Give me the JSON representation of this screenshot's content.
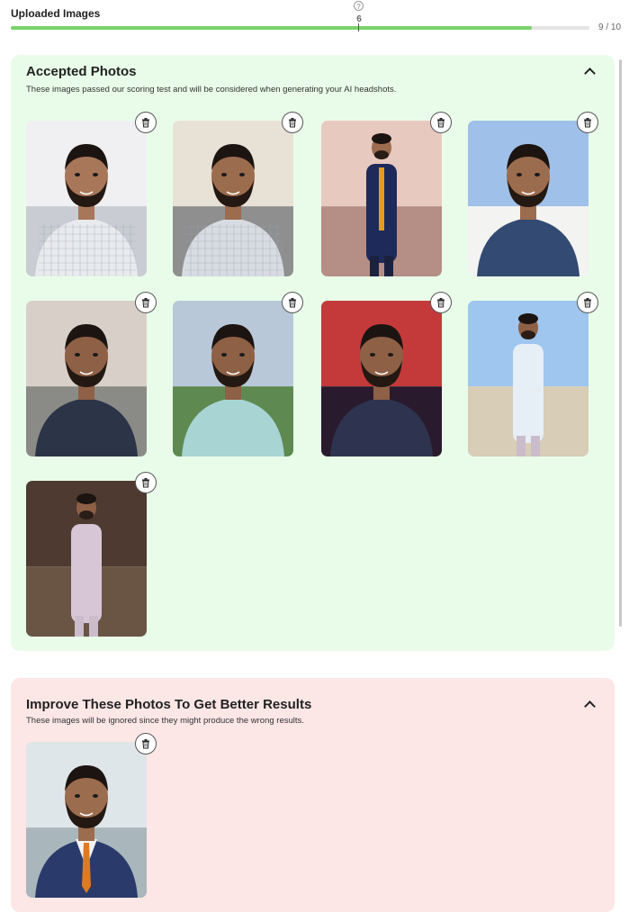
{
  "header": {
    "title": "Uploaded Images",
    "help_icon": "question-circle-icon",
    "marker_label": "6",
    "count_text": "9 / 10",
    "progress": 0.9,
    "accent_color": "#7ad26a"
  },
  "accepted": {
    "title": "Accepted Photos",
    "subtitle": "These images passed our scoring test and will be considered when generating your AI headshots.",
    "background": "#e9fce9",
    "photos": [
      {
        "icon": "trash-icon"
      },
      {
        "icon": "trash-icon"
      },
      {
        "icon": "trash-icon"
      },
      {
        "icon": "trash-icon"
      },
      {
        "icon": "trash-icon"
      },
      {
        "icon": "trash-icon"
      },
      {
        "icon": "trash-icon"
      },
      {
        "icon": "trash-icon"
      },
      {
        "icon": "trash-icon"
      }
    ]
  },
  "improve": {
    "title": "Improve These Photos To Get Better Results",
    "subtitle": "These images will be ignored since they might produce the wrong results.",
    "background": "#fde6e6",
    "photos": [
      {
        "icon": "trash-icon"
      }
    ]
  }
}
